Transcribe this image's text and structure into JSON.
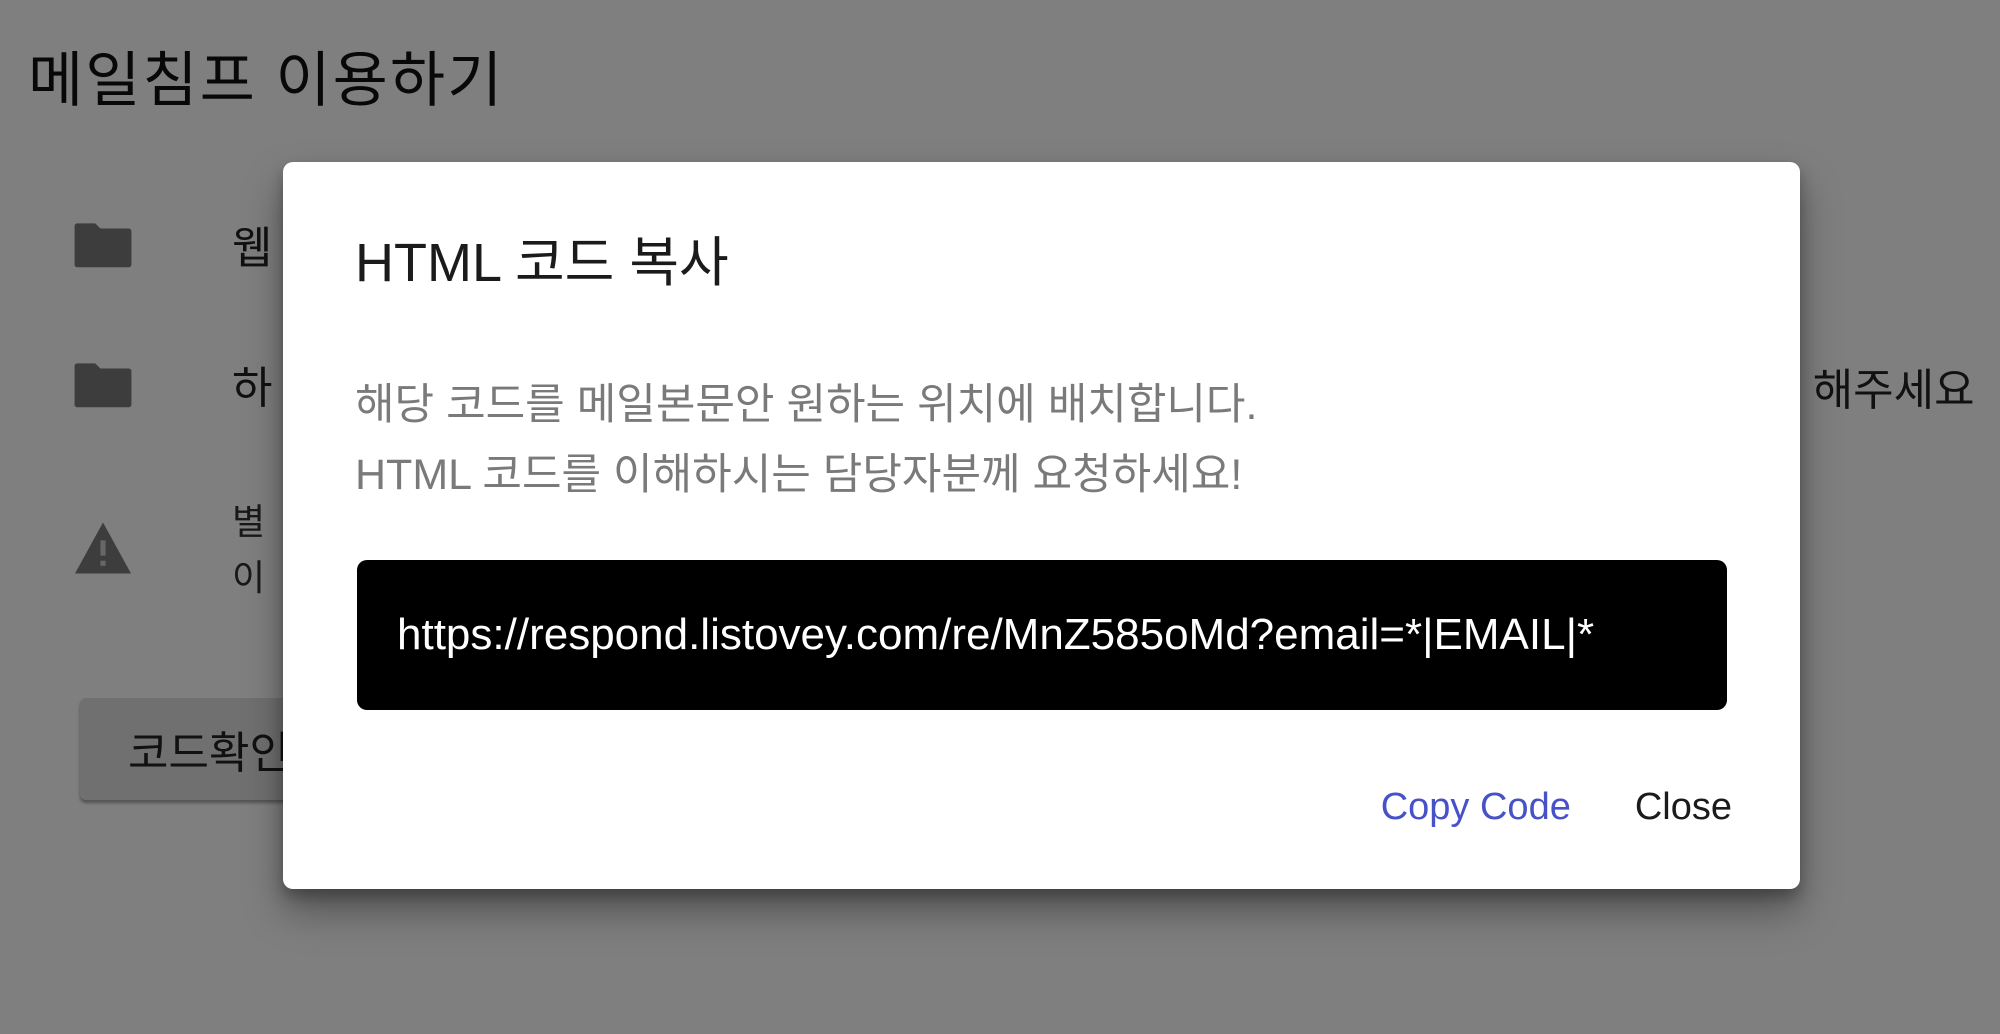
{
  "page": {
    "title": "메일침프 이용하기",
    "items": [
      {
        "icon": "folder-icon",
        "text": "웹"
      },
      {
        "icon": "folder-icon",
        "text": "하",
        "tail_text": "기 해주세요"
      },
      {
        "icon": "warning-icon",
        "lines": [
          "별",
          "이"
        ]
      }
    ],
    "check_code_button": "코드확인"
  },
  "dialog": {
    "title": "HTML 코드 복사",
    "description_lines": [
      "해당 코드를 메일본문안 원하는 위치에 배치합니다.",
      "HTML 코드를 이해하시는 담당자분께 요청하세요!"
    ],
    "code": "https://respond.listovey.com/re/MnZ585oMd?email=*|EMAIL|*",
    "actions": {
      "copy_label": "Copy Code",
      "close_label": "Close"
    }
  },
  "colors": {
    "accent": "#4751c8",
    "code_bg": "#000000",
    "scrim": "rgba(0,0,0,0.5)"
  }
}
